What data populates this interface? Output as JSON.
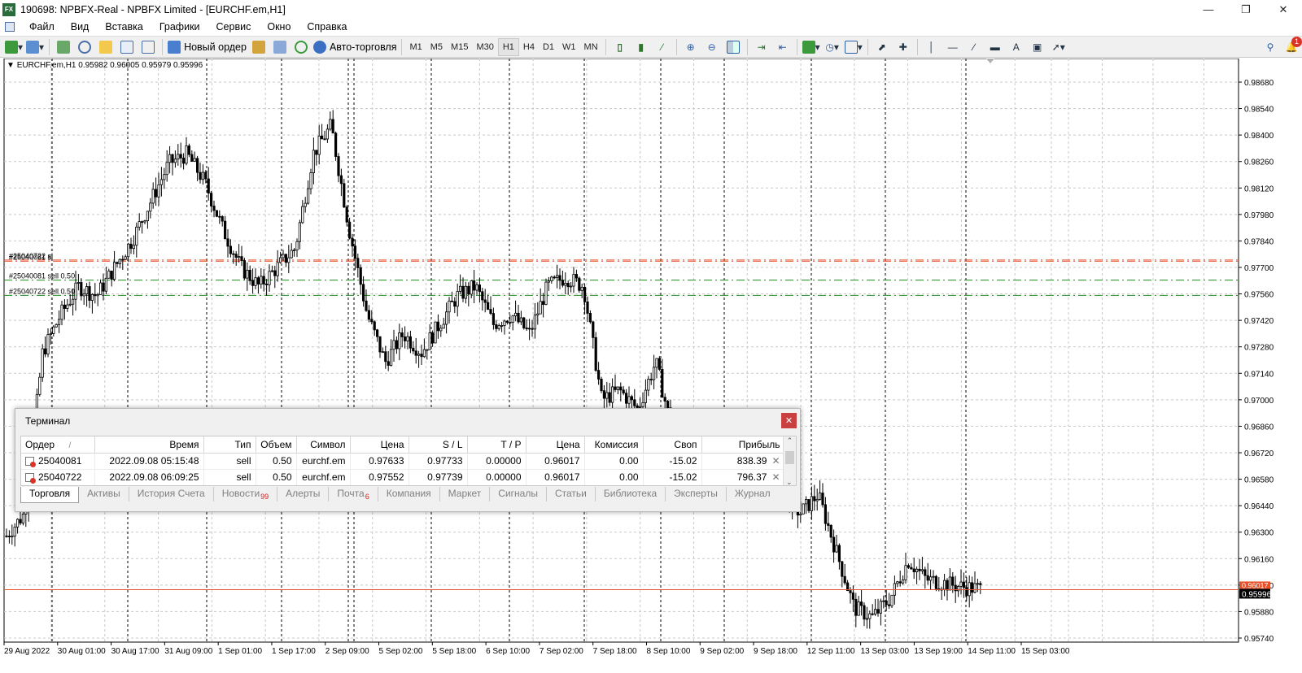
{
  "window": {
    "title": "190698: NPBFX-Real - NPBFX Limited - [EURCHF.em,H1]",
    "app_icon": "FX",
    "controls": [
      "minimize-icon",
      "maximize-icon",
      "close-icon"
    ]
  },
  "menu": {
    "items": [
      "Файл",
      "Вид",
      "Вставка",
      "Графики",
      "Сервис",
      "Окно",
      "Справка"
    ]
  },
  "toolbar": {
    "new_order_label": "Новый ордер",
    "autotrading_label": "Авто-торговля",
    "timeframes": [
      "M1",
      "M5",
      "M15",
      "M30",
      "H1",
      "H4",
      "D1",
      "W1",
      "MN"
    ],
    "selected_timeframe": "H1",
    "notification_count": "1"
  },
  "chart": {
    "header": "EURCHF.em,H1  0.95982 0.96005 0.95979 0.95996",
    "current_price": "0.95996",
    "current_price_hidden": "0.96017",
    "price_labels": [
      "0.98680",
      "0.98540",
      "0.98400",
      "0.98260",
      "0.98120",
      "0.97980",
      "0.97840",
      "0.97700",
      "0.97560",
      "0.97420",
      "0.97280",
      "0.97140",
      "0.97000",
      "0.96860",
      "0.96720",
      "0.96580",
      "0.96440",
      "0.96300",
      "0.96160",
      "0.96020",
      "0.95880",
      "0.95740"
    ],
    "time_labels": [
      "29 Aug 2022",
      "30 Aug 01:00",
      "30 Aug 17:00",
      "31 Aug 09:00",
      "1 Sep 01:00",
      "1 Sep 17:00",
      "2 Sep 09:00",
      "5 Sep 02:00",
      "5 Sep 18:00",
      "6 Sep 10:00",
      "7 Sep 02:00",
      "7 Sep 18:00",
      "8 Sep 10:00",
      "9 Sep 02:00",
      "9 Sep 18:00",
      "12 Sep 11:00",
      "13 Sep 03:00",
      "13 Sep 19:00",
      "14 Sep 11:00",
      "15 Sep 03:00"
    ],
    "order_lines": [
      {
        "label": "#25040722 sl",
        "price": 0.97739,
        "color": "#e8502a"
      },
      {
        "label": "#25040081 sl",
        "price": 0.97733,
        "color": "#e8502a"
      },
      {
        "label": "#25040081 sell 0.50",
        "price": 0.97633,
        "color": "#1a8a1a"
      },
      {
        "label": "#25040722 sell 0.50",
        "price": 0.97552,
        "color": "#1a8a1a"
      }
    ]
  },
  "chart_data": {
    "type": "candlestick",
    "symbol": "EURCHF.em",
    "timeframe": "H1",
    "ylim": [
      0.9571,
      0.9872
    ],
    "x_axis_labels": [
      "29 Aug 2022",
      "30 Aug 01:00",
      "30 Aug 17:00",
      "31 Aug 09:00",
      "1 Sep 01:00",
      "1 Sep 17:00",
      "2 Sep 09:00",
      "5 Sep 02:00",
      "5 Sep 18:00",
      "6 Sep 10:00",
      "7 Sep 02:00",
      "7 Sep 18:00",
      "8 Sep 10:00",
      "9 Sep 02:00",
      "9 Sep 18:00",
      "12 Sep 11:00",
      "13 Sep 03:00",
      "13 Sep 19:00",
      "14 Sep 11:00",
      "15 Sep 03:00"
    ],
    "close_path_estimate": [
      0.9628,
      0.964,
      0.9725,
      0.9745,
      0.976,
      0.9755,
      0.977,
      0.9785,
      0.9805,
      0.9825,
      0.983,
      0.9815,
      0.979,
      0.977,
      0.976,
      0.977,
      0.978,
      0.983,
      0.9845,
      0.979,
      0.9745,
      0.972,
      0.9735,
      0.9725,
      0.974,
      0.9755,
      0.976,
      0.974,
      0.9745,
      0.9735,
      0.976,
      0.9765,
      0.976,
      0.97,
      0.9705,
      0.9695,
      0.972,
      0.968,
      0.9665,
      0.9655,
      0.965,
      0.9655,
      0.968,
      0.965,
      0.964,
      0.965,
      0.962,
      0.959,
      0.9585,
      0.9595,
      0.9615,
      0.9605,
      0.9603,
      0.9601,
      0.96
    ],
    "last": {
      "open": 0.95982,
      "high": 0.96005,
      "low": 0.95979,
      "close": 0.95996
    }
  },
  "terminal": {
    "title": "Терминал",
    "columns": [
      "Ордер",
      "Время",
      "Тип",
      "Объем",
      "Символ",
      "Цена",
      "S / L",
      "T / P",
      "Цена",
      "Комиссия",
      "Своп",
      "Прибыль"
    ],
    "sort_indicator": "/",
    "rows": [
      {
        "order": "25040081",
        "time": "2022.09.08 05:15:48",
        "type": "sell",
        "volume": "0.50",
        "symbol": "eurchf.em",
        "price": "0.97633",
        "sl": "0.97733",
        "tp": "0.00000",
        "cur_price": "0.96017",
        "commission": "0.00",
        "swap": "-15.02",
        "profit": "838.39"
      },
      {
        "order": "25040722",
        "time": "2022.09.08 06:09:25",
        "type": "sell",
        "volume": "0.50",
        "symbol": "eurchf.em",
        "price": "0.97552",
        "sl": "0.97739",
        "tp": "0.00000",
        "cur_price": "0.96017",
        "commission": "0.00",
        "swap": "-15.02",
        "profit": "796.37"
      }
    ],
    "tabs": [
      {
        "label": "Торговля",
        "badge": ""
      },
      {
        "label": "Активы",
        "badge": ""
      },
      {
        "label": "История Счета",
        "badge": ""
      },
      {
        "label": "Новости",
        "badge": "99"
      },
      {
        "label": "Алерты",
        "badge": ""
      },
      {
        "label": "Почта",
        "badge": "6"
      },
      {
        "label": "Компания",
        "badge": ""
      },
      {
        "label": "Маркет",
        "badge": ""
      },
      {
        "label": "Сигналы",
        "badge": ""
      },
      {
        "label": "Статьи",
        "badge": ""
      },
      {
        "label": "Библиотека",
        "badge": ""
      },
      {
        "label": "Эксперты",
        "badge": ""
      },
      {
        "label": "Журнал",
        "badge": ""
      }
    ],
    "active_tab": "Торговля"
  }
}
